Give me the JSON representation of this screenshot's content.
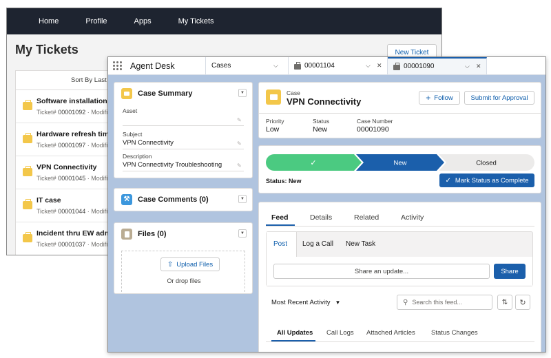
{
  "portal": {
    "nav": [
      "Home",
      "Profile",
      "Apps",
      "My Tickets"
    ],
    "title": "My Tickets",
    "new_ticket": "New Ticket",
    "sort_label": "Sort By Last M",
    "tickets": [
      {
        "title": "Software installation",
        "prefix": "Ticket# ",
        "number": "00001092",
        "suffix": " · Modifie"
      },
      {
        "title": "Hardware refresh timel",
        "prefix": "Ticket# ",
        "number": "00001097",
        "suffix": " · Modifie"
      },
      {
        "title": "VPN Connectivity",
        "prefix": "Ticket# ",
        "number": "00001045",
        "suffix": " · Modifie"
      },
      {
        "title": "IT case",
        "prefix": "Ticket# ",
        "number": "00001044",
        "suffix": " · Modifie"
      },
      {
        "title": "Incident thru EW admir",
        "prefix": "Ticket# ",
        "number": "00001037",
        "suffix": " · Modifie"
      }
    ]
  },
  "console": {
    "app_name": "Agent Desk",
    "nav_item": "Cases",
    "tabs": [
      {
        "label": "00001104"
      },
      {
        "label": "00001090"
      }
    ],
    "case_summary": {
      "title": "Case Summary",
      "asset_label": "Asset",
      "asset_value": "",
      "subject_label": "Subject",
      "subject_value": "VPN Connectivity",
      "description_label": "Description",
      "description_value": "VPN Connectivity Troubleshooting"
    },
    "case_comments": {
      "title": "Case Comments (0)"
    },
    "files": {
      "title": "Files (0)",
      "upload": "Upload Files",
      "drop": "Or drop files"
    },
    "record": {
      "object": "Case",
      "name": "VPN Connectivity",
      "follow": "Follow",
      "submit": "Submit for Approval",
      "fields": [
        {
          "label": "Priority",
          "value": "Low"
        },
        {
          "label": "Status",
          "value": "New"
        },
        {
          "label": "Case Number",
          "value": "00001090"
        }
      ]
    },
    "path": {
      "steps": [
        {
          "label": "",
          "state": "complete"
        },
        {
          "label": "New",
          "state": "current"
        },
        {
          "label": "Closed",
          "state": "incomplete"
        }
      ],
      "status_text": "Status: New",
      "mark_complete": "Mark Status as Complete"
    },
    "feed": {
      "tabs": [
        "Feed",
        "Details",
        "Related",
        "Activity"
      ],
      "publisher_tabs": [
        "Post",
        "Log a Call",
        "New Task"
      ],
      "share_placeholder": "Share an update...",
      "share_button": "Share",
      "sort_label": "Most Recent Activity",
      "search_placeholder": "Search this feed...",
      "filters": [
        "All Updates",
        "Call Logs",
        "Attached Articles",
        "Status Changes"
      ]
    },
    "colors": {
      "brand": "#1b5fab",
      "complete_green": "#4bca81",
      "console_bg": "#b0c4df",
      "case_icon": "#f3c74a"
    }
  }
}
